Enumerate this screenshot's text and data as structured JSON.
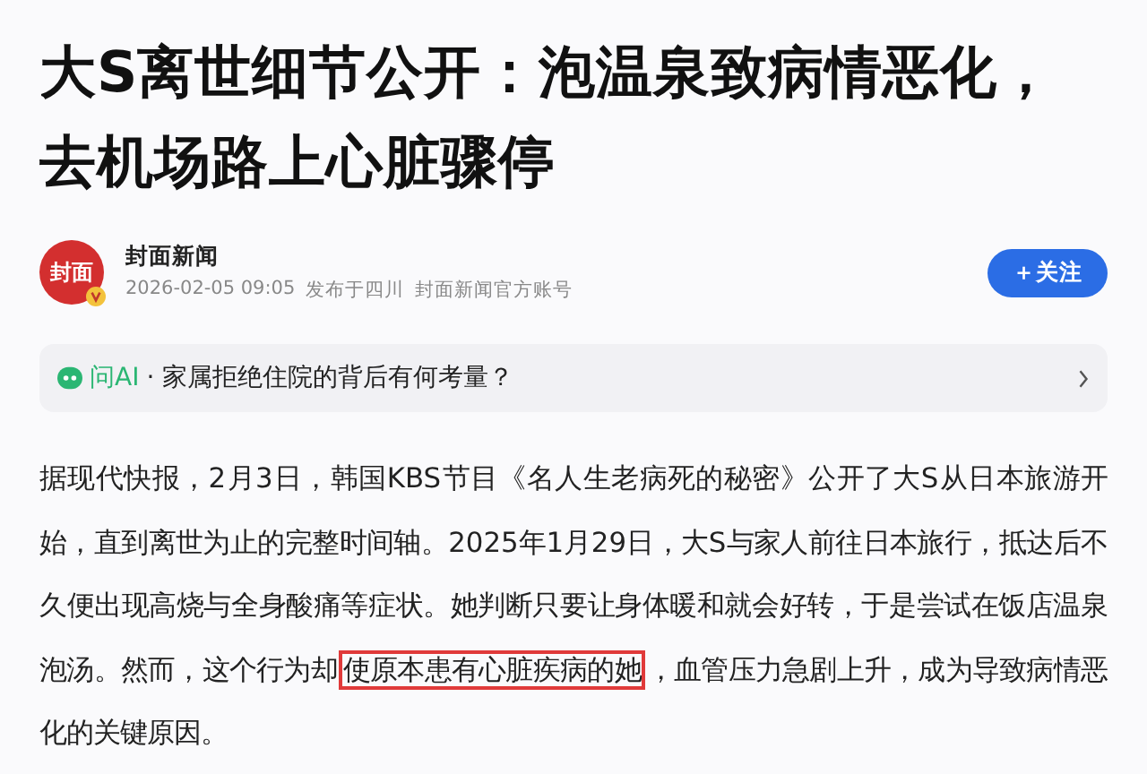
{
  "title": "大S离世细节公开：泡温泉致病情恶化，去机场路上心脏骤停",
  "author": {
    "logo_text": "封面",
    "name": "封面新闻",
    "time": "2026-02-05 09:05",
    "location": "发布于四川",
    "account": "封面新闻官方账号",
    "follow_label": "＋关注"
  },
  "ask_ai": {
    "label": "问AI",
    "question": "· 家属拒绝住院的背后有何考量？"
  },
  "body": [
    {
      "kind": "plain",
      "text": "据现代快报，2月3日，韩国KBS节目《名人生老病死的秘密》公开了大S从日本旅游开始，直到离世为止的完整时间轴。2025年1月29日，大S与家人前往日本旅行，抵达后不久便出现高烧与全身酸痛等症状。她判断只要让身体暖和就会好转，于是尝试在饭店温泉泡汤。然而，这个行为却"
    },
    {
      "kind": "highlight",
      "text": "使原本患有心脏疾病的她"
    },
    {
      "kind": "plain",
      "text": "，血管压力急剧上升，成为导致病情恶化的关键原因。"
    }
  ]
}
